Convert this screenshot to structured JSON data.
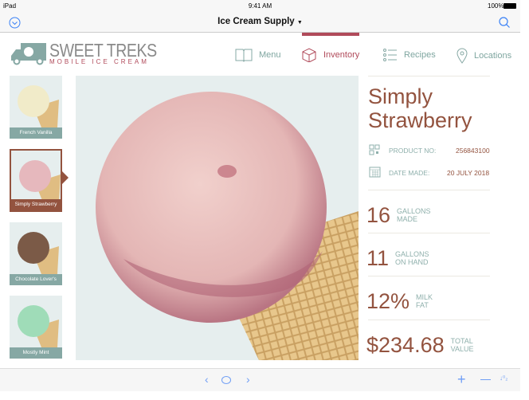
{
  "status": {
    "device": "iPad",
    "time": "9:41 AM",
    "battery": "100%"
  },
  "navbar": {
    "title": "Ice Cream Supply"
  },
  "brand": {
    "name": "SWEET TREKS",
    "tagline": "MOBILE ICE CREAM"
  },
  "tabs": [
    {
      "label": "Menu",
      "icon": "book-icon"
    },
    {
      "label": "Inventory",
      "icon": "box-icon",
      "active": true
    },
    {
      "label": "Recipes",
      "icon": "list-icon"
    },
    {
      "label": "Locations",
      "icon": "map-pin-icon"
    }
  ],
  "flavors": [
    {
      "name": "French Vanilla",
      "color": "#f1ebc9"
    },
    {
      "name": "Simply Strawberry",
      "color": "#e6b8bd",
      "selected": true
    },
    {
      "name": "Chocolate Lover's",
      "color": "#7b5a47"
    },
    {
      "name": "Mostly Mint",
      "color": "#9fdcb8"
    }
  ],
  "detail": {
    "title_line1": "Simply",
    "title_line2": "Strawberry",
    "product_label": "PRODUCT NO:",
    "product_no": "256843100",
    "date_label": "DATE MADE:",
    "date": "20 JULY 2018",
    "stats": [
      {
        "value": "16",
        "l1": "GALLONS",
        "l2": "MADE"
      },
      {
        "value": "11",
        "l1": "GALLONS",
        "l2": "ON HAND"
      },
      {
        "value": "12%",
        "l1": "MILK",
        "l2": "FAT"
      },
      {
        "value": "$234.68",
        "l1": "TOTAL",
        "l2": "VALUE"
      }
    ]
  },
  "colors": {
    "accent": "#93533f",
    "teal": "#86a8a4",
    "active_tab": "#b04a5a",
    "ios_blue": "#3b82f6"
  }
}
